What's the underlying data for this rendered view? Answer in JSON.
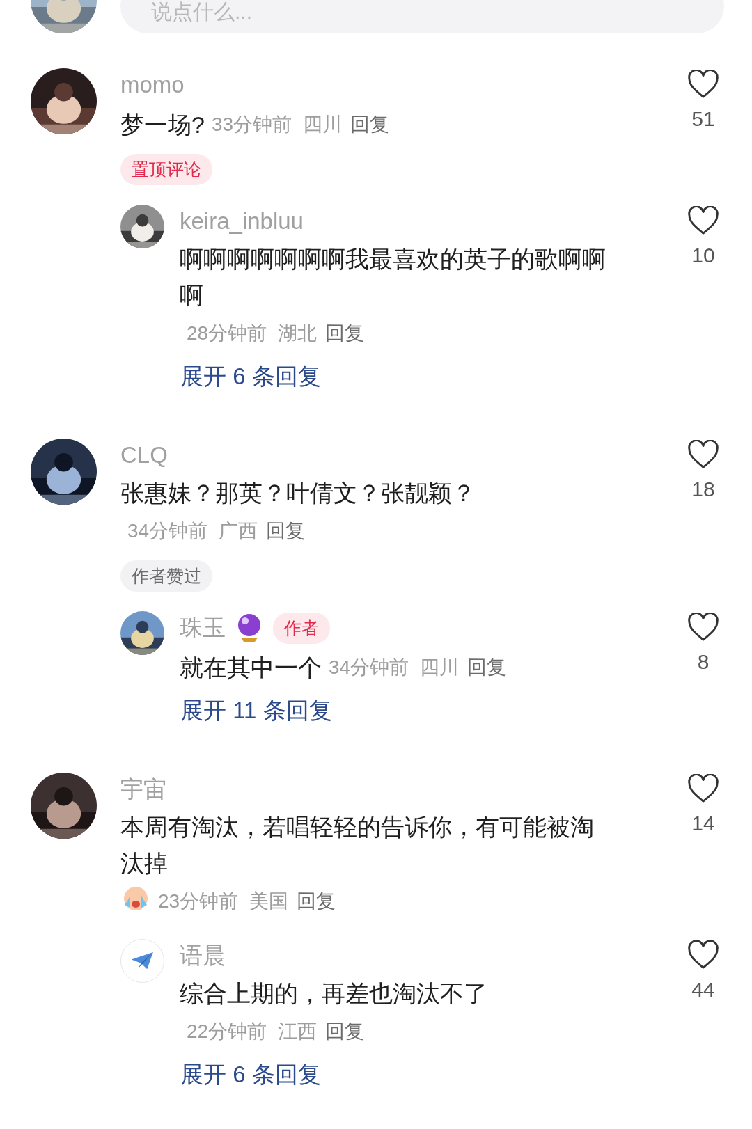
{
  "composer": {
    "placeholder": "说点什么..."
  },
  "comments": [
    {
      "user": "momo",
      "text": "梦一场?",
      "time": "33分钟前",
      "location": "四川",
      "reply_label": "回复",
      "likes": "51",
      "badge": {
        "kind": "pinned",
        "label": "置顶评论"
      },
      "replies": [
        {
          "user": "keira_inbluu",
          "text": "啊啊啊啊啊啊啊我最喜欢的英子的歌啊啊啊",
          "time": "28分钟前",
          "location": "湖北",
          "reply_label": "回复",
          "likes": "10"
        }
      ],
      "expand_label": "展开 6 条回复"
    },
    {
      "user": "CLQ",
      "text": "张惠妹？那英？叶倩文？张靓颖？",
      "time": "34分钟前",
      "location": "广西",
      "reply_label": "回复",
      "likes": "18",
      "badge": {
        "kind": "liked",
        "label": "作者赞过"
      },
      "replies": [
        {
          "user": "珠玉",
          "emblem": true,
          "tag": "作者",
          "text": "就在其中一个",
          "time": "34分钟前",
          "location": "四川",
          "reply_label": "回复",
          "likes": "8"
        }
      ],
      "expand_label": "展开 11 条回复"
    },
    {
      "user": "宇宙",
      "text": "本周有淘汰，若唱轻轻的告诉你，有可能被淘汰掉",
      "emoji": true,
      "time": "23分钟前",
      "location": "美国",
      "reply_label": "回复",
      "likes": "14",
      "replies": [
        {
          "user": "语晨",
          "avatar": {
            "kind": "icon"
          },
          "text": "综合上期的，再差也淘汰不了",
          "time": "22分钟前",
          "location": "江西",
          "reply_label": "回复",
          "likes": "44"
        }
      ],
      "expand_label": "展开 6 条回复"
    }
  ]
}
